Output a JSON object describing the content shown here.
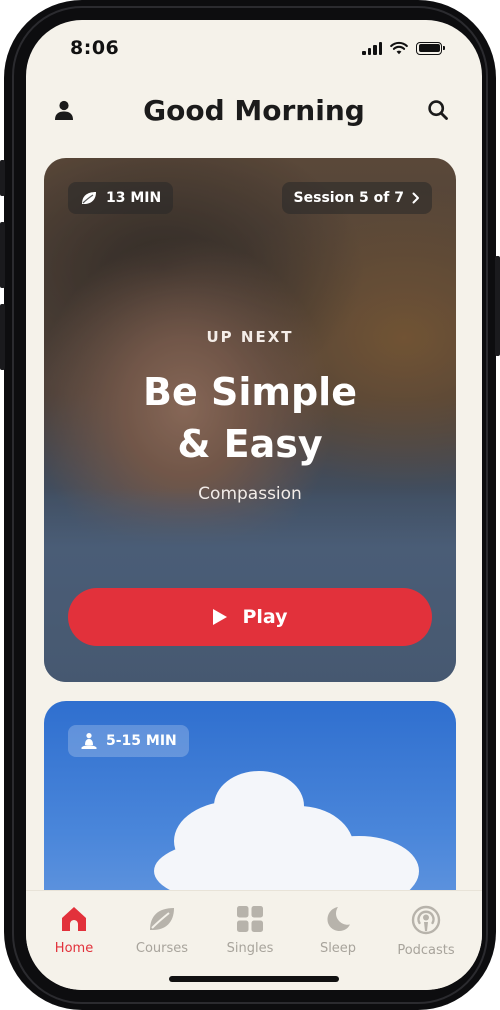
{
  "status_bar": {
    "time": "8:06"
  },
  "header": {
    "title": "Good Morning"
  },
  "hero": {
    "duration_label": "13 MIN",
    "session_label": "Session 5 of 7",
    "kicker": "UP NEXT",
    "title_line1": "Be Simple",
    "title_line2": "& Easy",
    "subtitle": "Compassion",
    "play_label": "Play"
  },
  "second_card": {
    "duration_label": "5-15 MIN"
  },
  "tab_bar": {
    "items": [
      {
        "label": "Home",
        "icon": "home-icon",
        "active": true
      },
      {
        "label": "Courses",
        "icon": "leaf-icon",
        "active": false
      },
      {
        "label": "Singles",
        "icon": "grid-icon",
        "active": false
      },
      {
        "label": "Sleep",
        "icon": "moon-icon",
        "active": false
      },
      {
        "label": "Podcasts",
        "icon": "podcast-icon",
        "active": false
      }
    ]
  },
  "colors": {
    "accent": "#e2313b",
    "background": "#f5f2ea",
    "inactive_tab": "#a8a49c"
  }
}
